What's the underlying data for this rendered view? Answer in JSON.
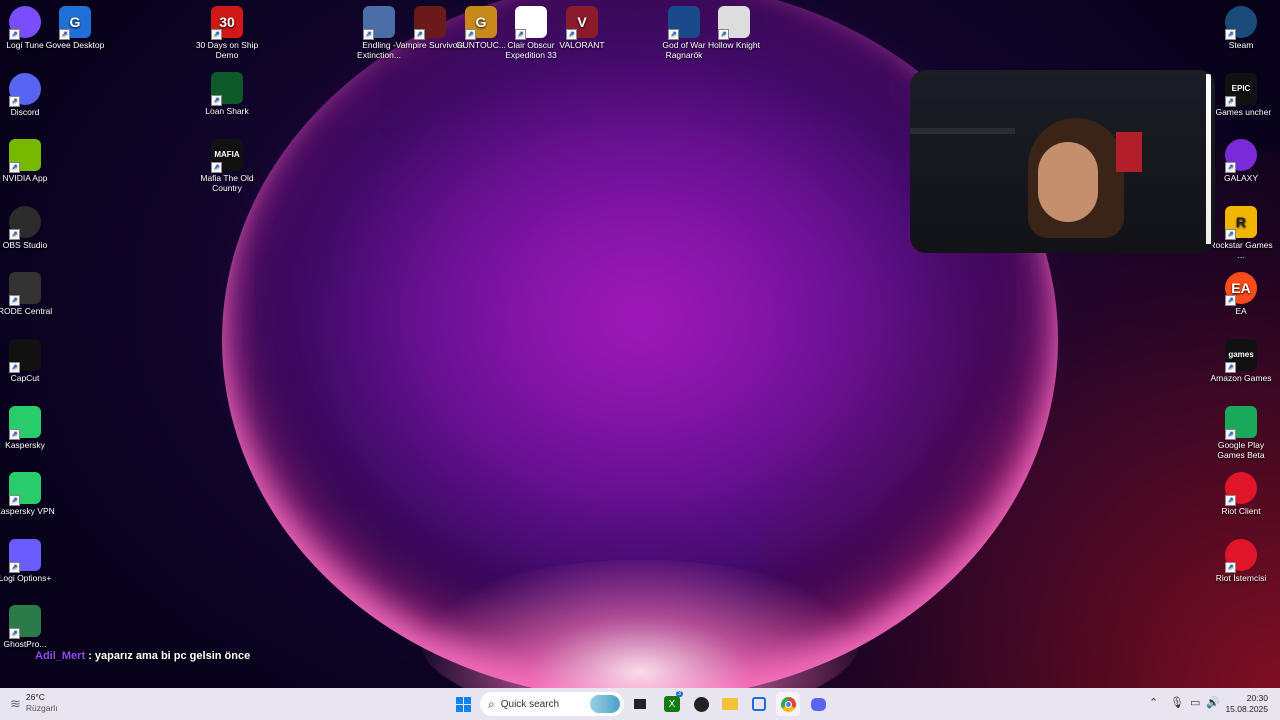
{
  "desktop": {
    "icons_left": [
      {
        "label": "Logi Tune",
        "icon": "logi-tune-icon",
        "color": "#7a4dff"
      },
      {
        "label": "Discord",
        "icon": "discord-icon",
        "color": "#5865f2"
      },
      {
        "label": "NVIDIA App",
        "icon": "nvidia-icon",
        "color": "#76b900"
      },
      {
        "label": "OBS Studio",
        "icon": "obs-icon",
        "color": "#2b2b2b"
      },
      {
        "label": "RODE Central",
        "icon": "rode-icon",
        "color": "#333333"
      },
      {
        "label": "CapCut",
        "icon": "capcut-icon",
        "color": "#111111"
      },
      {
        "label": "Kaspersky",
        "icon": "kaspersky-icon",
        "color": "#29cc6a"
      },
      {
        "label": "Kaspersky VPN",
        "icon": "kaspersky-vpn-icon",
        "color": "#29cc6a"
      },
      {
        "label": "Logi Options+",
        "icon": "logi-options-icon",
        "color": "#6a5cff"
      },
      {
        "label": "GhostPro...",
        "icon": "ghostpro-icon",
        "color": "#2a7a4a"
      }
    ],
    "icons_col2": [
      {
        "label": "Govee Desktop",
        "icon": "govee-icon",
        "color": "#1f6fd6",
        "glyph": "G"
      },
      {
        "label": "30 Days on Ship Demo",
        "icon": "30-days-icon",
        "color": "#d01818",
        "glyph": "30"
      },
      {
        "label": "Loan Shark",
        "icon": "loan-shark-icon",
        "color": "#0e5a2a"
      },
      {
        "label": "Mafia The Old Country",
        "icon": "mafia-icon",
        "color": "#111111",
        "glyph": "MAFIA"
      }
    ],
    "icons_top": [
      {
        "label": "Endling - Extinction...",
        "icon": "endling-icon",
        "color": "#4a6fa8"
      },
      {
        "label": "Vampire Survivors",
        "icon": "vampire-survivors-icon",
        "color": "#6a1a1a"
      },
      {
        "label": "GUNTOUC...",
        "icon": "guntouch-icon",
        "color": "#c9891a",
        "glyph": "G"
      },
      {
        "label": "Clair Obscur Expedition 33",
        "icon": "file-icon",
        "color": "#ffffff"
      },
      {
        "label": "VALORANT",
        "icon": "valorant-icon",
        "color": "#8b1a2a",
        "glyph": "V"
      },
      {
        "label": "God of War Ragnarök",
        "icon": "god-of-war-icon",
        "color": "#1a4a8a"
      },
      {
        "label": "Hollow Knight",
        "icon": "hollow-knight-icon",
        "color": "#dddddd"
      }
    ],
    "icons_right": [
      {
        "label": "Steam",
        "icon": "steam-icon",
        "color": "#1b4b7a"
      },
      {
        "label": ": Games uncher",
        "icon": "epic-games-icon",
        "color": "#111111",
        "glyph": "EPIC"
      },
      {
        "label": "GALAXY",
        "icon": "galaxy-icon",
        "color": "#7a2ad8"
      },
      {
        "label": "Rockstar Games ...",
        "icon": "rockstar-icon",
        "color": "#f2b600",
        "glyph": "R"
      },
      {
        "label": "EA",
        "icon": "ea-icon",
        "color": "#ff4a1a",
        "glyph": "EA"
      },
      {
        "label": "Amazon Games",
        "icon": "amazon-games-icon",
        "color": "#111111",
        "glyph": "games"
      },
      {
        "label": "Google Play Games Beta",
        "icon": "google-play-games-icon",
        "color": "#1aa85a"
      },
      {
        "label": "Riot Client",
        "icon": "riot-client-icon",
        "color": "#e0152a"
      },
      {
        "label": "Riot İstemcisi",
        "icon": "riot-istemcisi-icon",
        "color": "#e0152a"
      }
    ]
  },
  "chat": {
    "user": "Adil_Mert",
    "separator": ":",
    "message": "yaparız ama bi pc gelsin önce"
  },
  "taskbar": {
    "weather": {
      "temp": "26°C",
      "condition": "Rüzgarlı"
    },
    "search_placeholder": "Quick search",
    "xbox_badge": "3",
    "clock": {
      "time": "20:30",
      "date": "15.08.2025"
    }
  }
}
